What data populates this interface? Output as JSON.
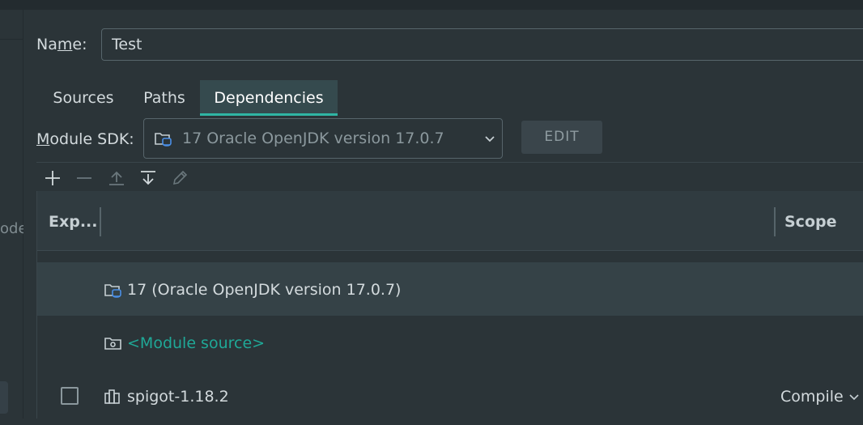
{
  "left_pane": {
    "cut_text": "ode"
  },
  "form": {
    "name_label_pre": "Na",
    "name_label_u": "m",
    "name_label_post": "e:",
    "name_value": "Test"
  },
  "tabs": [
    {
      "label": "Sources",
      "active": false
    },
    {
      "label": "Paths",
      "active": false
    },
    {
      "label": "Dependencies",
      "active": true
    }
  ],
  "sdk": {
    "label_u": "M",
    "label_rest": "odule SDK:",
    "selected": "17 Oracle OpenJDK version 17.0.7",
    "edit_label": "EDIT"
  },
  "toolbar": {
    "icons": [
      "add-icon",
      "remove-icon",
      "move-up-icon",
      "move-down-icon",
      "edit-pencil-icon"
    ]
  },
  "table": {
    "columns": [
      "Exp...",
      "",
      "Scope"
    ],
    "rows": [
      {
        "icon": "jdk-folder-icon",
        "text": "17 (Oracle OpenJDK version 17.0.7)",
        "selected": true,
        "checkbox": false,
        "scope": ""
      },
      {
        "icon": "module-source-folder-icon",
        "text": "<Module source>",
        "selected": false,
        "checkbox": false,
        "scope": ""
      },
      {
        "icon": "library-icon",
        "text": "spigot-1.18.2",
        "selected": false,
        "checkbox": true,
        "checked": false,
        "scope": "Compile"
      }
    ]
  },
  "colors": {
    "background": "#2b3438",
    "accent": "#2fb5a4",
    "link": "#1fa897",
    "text": "#d3dadd"
  }
}
